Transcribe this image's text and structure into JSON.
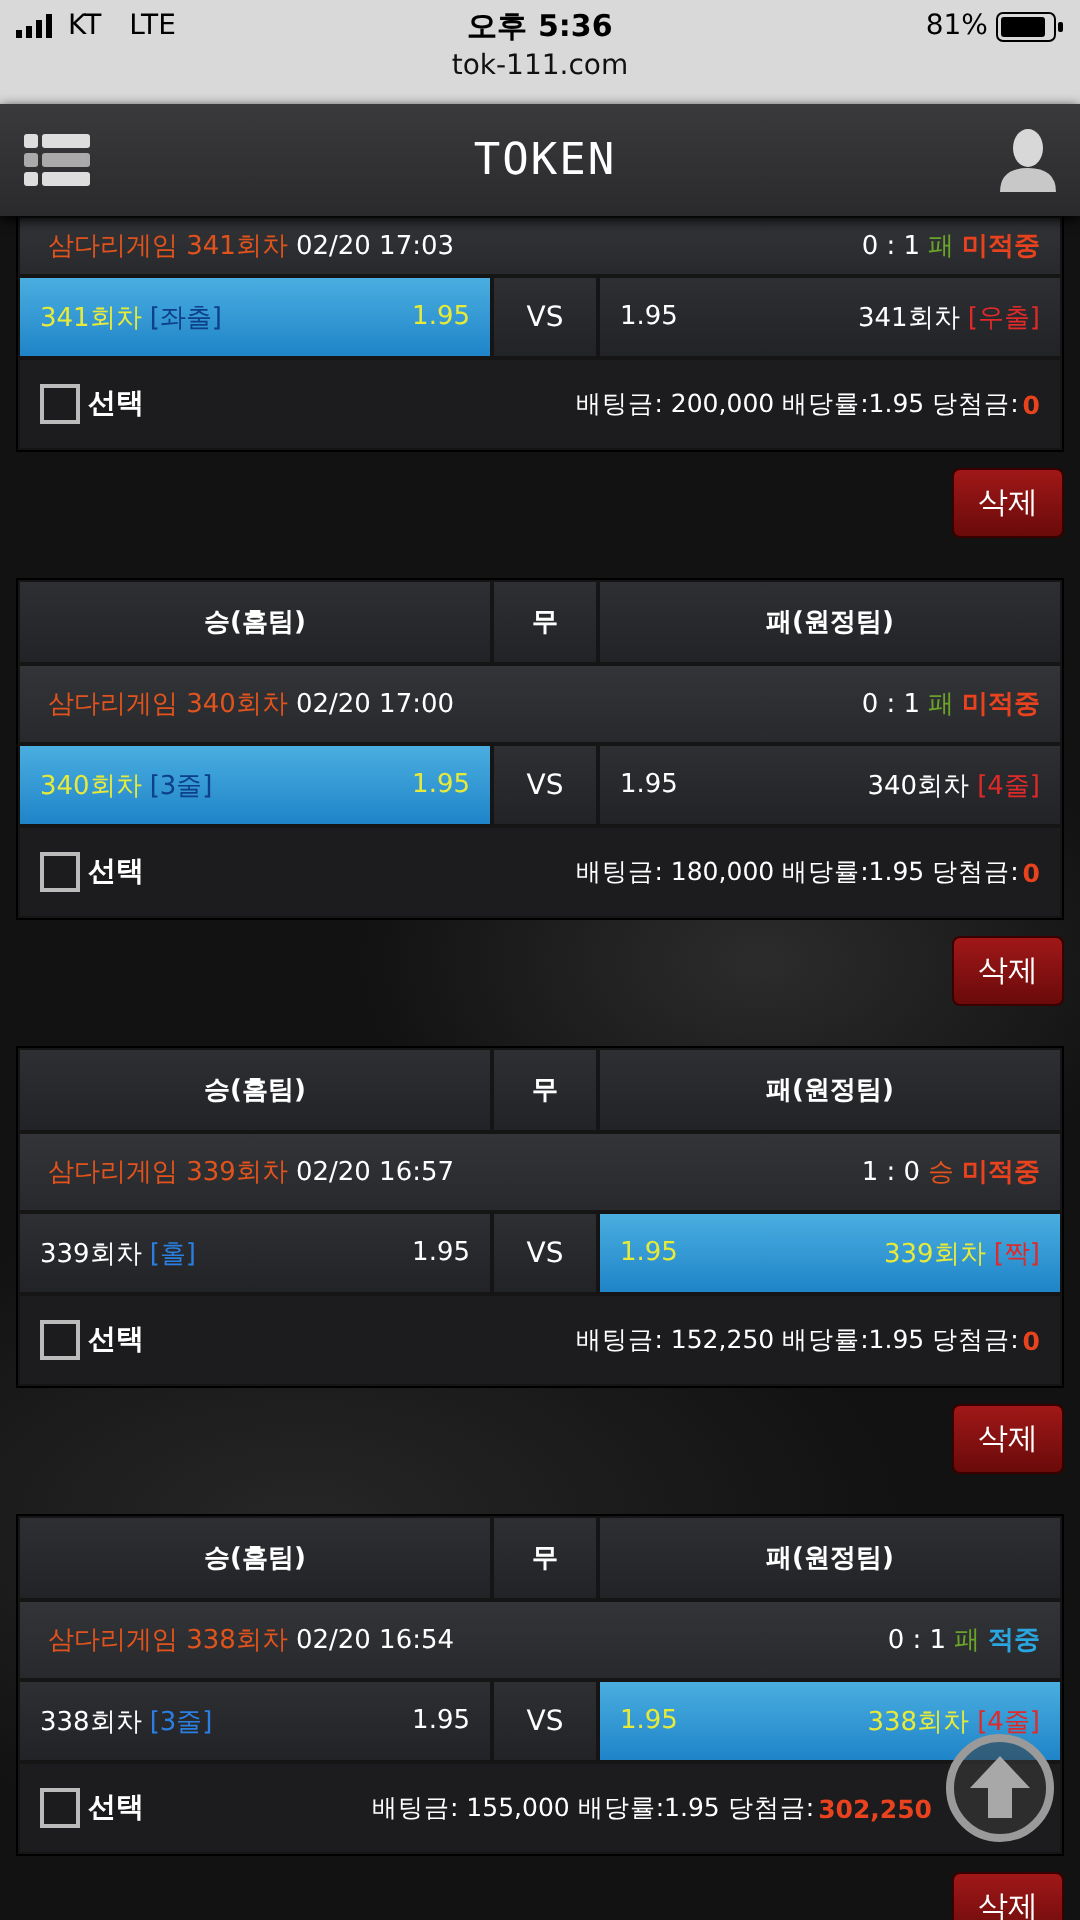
{
  "status_bar": {
    "carrier": "KT",
    "network": "LTE",
    "time": "오후 5:36",
    "battery": "81%"
  },
  "browser": {
    "url": "tok-111.com"
  },
  "nav": {
    "title": "TOKEN"
  },
  "bets": [
    {
      "game": "삼다리게임 341회차",
      "time": "02/20 17:03",
      "score": "0 : 1",
      "result": {
        "text": "패",
        "color": "#6aa329"
      },
      "status": {
        "text": "미적중",
        "hit": false
      },
      "home": {
        "round": "341회차",
        "tag": "[좌출]",
        "odds": "1.95",
        "selected": true
      },
      "vs": "VS",
      "away": {
        "odds": "1.95",
        "round": "341회차",
        "tag": "[우출]",
        "selected": false
      },
      "checkbox": {
        "label": "선택",
        "checked": false
      },
      "info": "배팅금: 200,000 배당률:1.95 당첨금:",
      "win": "0",
      "delete": "삭제"
    },
    {
      "header": {
        "home": "승(홈팀)",
        "draw": "무",
        "away": "패(원정팀)"
      },
      "game": "삼다리게임 340회차",
      "time": "02/20 17:00",
      "score": "0 : 1",
      "result": {
        "text": "패",
        "color": "#6aa329"
      },
      "status": {
        "text": "미적중",
        "hit": false
      },
      "home": {
        "round": "340회차",
        "tag": "[3줄]",
        "odds": "1.95",
        "selected": true
      },
      "vs": "VS",
      "away": {
        "odds": "1.95",
        "round": "340회차",
        "tag": "[4줄]",
        "selected": false
      },
      "checkbox": {
        "label": "선택",
        "checked": false
      },
      "info": "배팅금: 180,000 배당률:1.95 당첨금:",
      "win": "0",
      "delete": "삭제"
    },
    {
      "header": {
        "home": "승(홈팀)",
        "draw": "무",
        "away": "패(원정팀)"
      },
      "game": "삼다리게임 339회차",
      "time": "02/20 16:57",
      "score": "1 : 0",
      "result": {
        "text": "승",
        "color": "#e0531c"
      },
      "status": {
        "text": "미적중",
        "hit": false
      },
      "home": {
        "round": "339회차",
        "tag": "[홀]",
        "odds": "1.95",
        "selected": false
      },
      "vs": "VS",
      "away": {
        "odds": "1.95",
        "round": "339회차",
        "tag": "[짝]",
        "selected": true
      },
      "checkbox": {
        "label": "선택",
        "checked": false
      },
      "info": "배팅금: 152,250 배당률:1.95 당첨금:",
      "win": "0",
      "delete": "삭제"
    },
    {
      "header": {
        "home": "승(홈팀)",
        "draw": "무",
        "away": "패(원정팀)"
      },
      "game": "삼다리게임 338회차",
      "time": "02/20 16:54",
      "score": "0 : 1",
      "result": {
        "text": "패",
        "color": "#6aa329"
      },
      "status": {
        "text": "적중",
        "hit": true
      },
      "home": {
        "round": "338회차",
        "tag": "[3줄]",
        "odds": "1.95",
        "selected": false
      },
      "vs": "VS",
      "away": {
        "odds": "1.95",
        "round": "338회차",
        "tag": "[4줄]",
        "selected": true
      },
      "checkbox": {
        "label": "선택",
        "checked": false
      },
      "info": "배팅금: 155,000 배당률:1.95 당첨금:",
      "win": "302,250",
      "delete": "삭제"
    }
  ]
}
